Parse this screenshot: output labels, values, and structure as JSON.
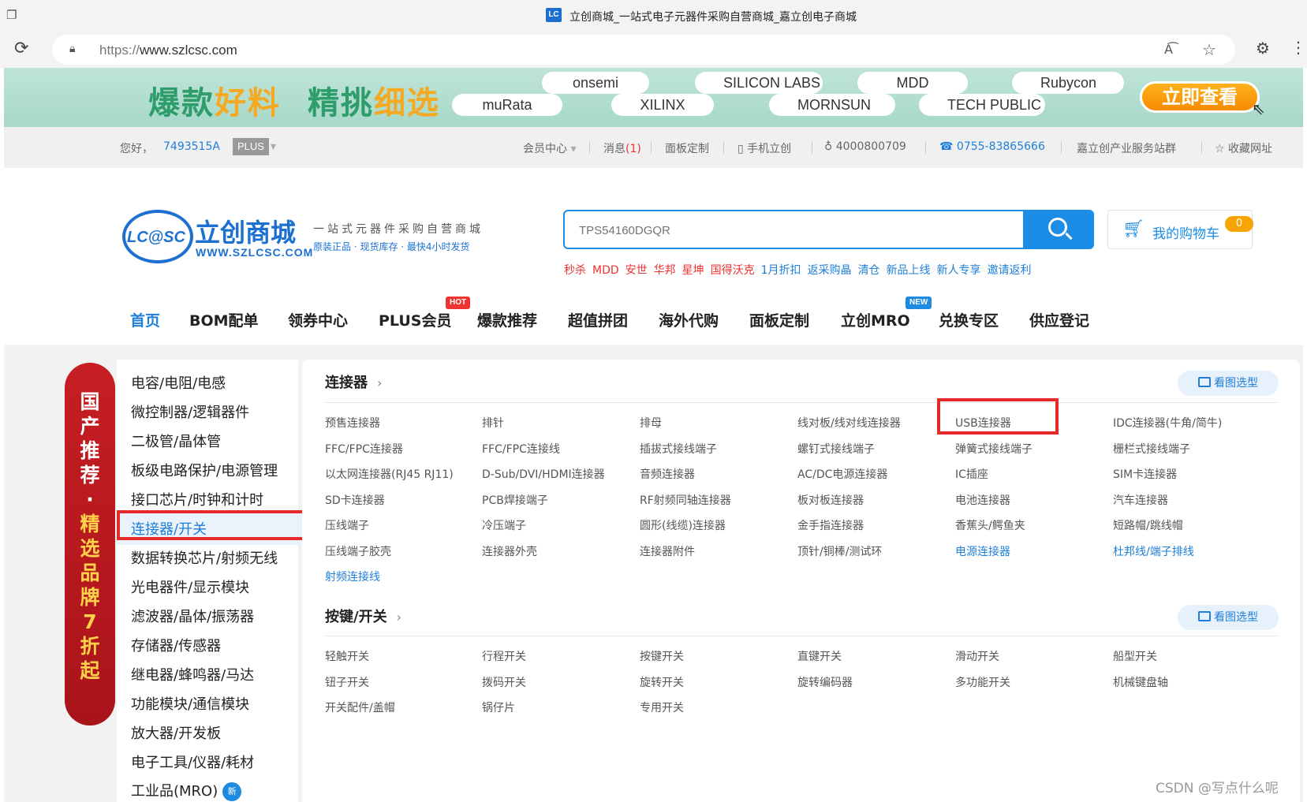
{
  "browser": {
    "tab_title": "立创商城_一站式电子元器件采购自营商城_嘉立创电子商城",
    "favicon_text": "LC",
    "url": "https://www.szlcsc.com",
    "url_scheme": "https://",
    "url_host": "www.szlcsc.com",
    "reader_icon": "Aᴬ"
  },
  "banner": {
    "slogan_green_1": "爆款",
    "slogan_yellow_1": "好料",
    "slogan_green_2": "精挑",
    "slogan_yellow_2": "细选",
    "brands": [
      "onsemi",
      "muRata",
      "XILINX",
      "SILICON LABS",
      "MORNSUN",
      "MDD",
      "TECH PUBLIC",
      "Rubycon"
    ],
    "cta_label": "立即查看",
    "colors": {
      "green": "#2e9d6b",
      "yellow": "#f5a821",
      "cta": "#f58a00"
    }
  },
  "memberbar": {
    "greeting": "您好，",
    "username": "7493515A",
    "plus_badge": "PLUS",
    "member_center": "会员中心",
    "messages_label": "消息",
    "messages_count": "(1)",
    "panel_custom": "面板定制",
    "mobile": "手机立创",
    "qq": "4000800709",
    "phone": "0755-83865666",
    "industry": "嘉立创产业服务站群",
    "favorite": "收藏网址"
  },
  "header": {
    "logo_badge": "LC@SC",
    "logo_cn": "立创商城",
    "logo_url": "WWW.SZLCSC.COM",
    "tagline_1": "一站式元器件采购自营商城",
    "tagline_2": "原装正品 · 现货库存 · 最快4小时发货",
    "search_placeholder": "TPS54160DGQR",
    "cart_label": "我的购物车",
    "cart_count": "0",
    "hotwords": [
      {
        "text": "秒杀",
        "color": "#e33"
      },
      {
        "text": "MDD",
        "color": "#e33"
      },
      {
        "text": "安世",
        "color": "#e33"
      },
      {
        "text": "华邦",
        "color": "#e33"
      },
      {
        "text": "星坤",
        "color": "#e33"
      },
      {
        "text": "国得沃克",
        "color": "#e33"
      },
      {
        "text": "1月折扣",
        "color": "#1e7ed8"
      },
      {
        "text": "返采购晶",
        "color": "#1e7ed8"
      },
      {
        "text": "清仓",
        "color": "#1e7ed8"
      },
      {
        "text": "新品上线",
        "color": "#1e7ed8"
      },
      {
        "text": "新人专享",
        "color": "#1e7ed8"
      },
      {
        "text": "邀请返利",
        "color": "#1e7ed8"
      }
    ]
  },
  "nav": {
    "items": [
      "首页",
      "BOM配单",
      "领券中心",
      "PLUS会员",
      "爆款推荐",
      "超值拼团",
      "海外代购",
      "面板定制",
      "立创MRO",
      "兑换专区",
      "供应登记"
    ],
    "hot_tag": "HOT",
    "new_tag": "NEW"
  },
  "promo": {
    "line1": "国产推荐",
    "dot": "·",
    "line2": "精选品牌",
    "line3": "7折起"
  },
  "categories": [
    "电容/电阻/电感",
    "微控制器/逻辑器件",
    "二极管/晶体管",
    "板级电路保护/电源管理",
    "接口芯片/时钟和计时",
    "连接器/开关",
    "数据转换芯片/射频无线",
    "光电器件/显示模块",
    "滤波器/晶体/振荡器",
    "存储器/传感器",
    "继电器/蜂鸣器/马达",
    "功能模块/通信模块",
    "放大器/开发板",
    "电子工具/仪器/耗材",
    "工业品(MRO)"
  ],
  "category_new_badge": "新",
  "panel": {
    "connectors": {
      "title": "连接器",
      "chevron": "›",
      "view_label": "看图选型",
      "rows": [
        [
          "预售连接器",
          "排针",
          "排母",
          "线对板/线对线连接器",
          "USB连接器",
          "IDC连接器(牛角/简牛)"
        ],
        [
          "FFC/FPC连接器",
          "FFC/FPC连接线",
          "插拔式接线端子",
          "螺钉式接线端子",
          "弹簧式接线端子",
          "栅栏式接线端子"
        ],
        [
          "以太网连接器(RJ45 RJ11)",
          "D-Sub/DVI/HDMI连接器",
          "音频连接器",
          "AC/DC电源连接器",
          "IC插座",
          "SIM卡连接器"
        ],
        [
          "SD卡连接器",
          "PCB焊接端子",
          "RF射频同轴连接器",
          "板对板连接器",
          "电池连接器",
          "汽车连接器"
        ],
        [
          "压线端子",
          "冷压端子",
          "圆形(线缆)连接器",
          "金手指连接器",
          "香蕉头/鳄鱼夹",
          "短路帽/跳线帽"
        ],
        [
          "压线端子胶壳",
          "连接器外壳",
          "连接器附件",
          "顶针/铜棒/测试环",
          "电源连接器",
          "杜邦线/端子排线"
        ],
        [
          "射频连接线"
        ]
      ]
    },
    "switches": {
      "title": "按键/开关",
      "chevron": "›",
      "view_label": "看图选型",
      "rows": [
        [
          "轻触开关",
          "行程开关",
          "按键开关",
          "直键开关",
          "滑动开关",
          "船型开关"
        ],
        [
          "钮子开关",
          "拨码开关",
          "旋转开关",
          "旋转编码器",
          "多功能开关",
          "机械键盘轴"
        ],
        [
          "开关配件/盖帽",
          "锅仔片",
          "专用开关"
        ]
      ]
    }
  },
  "watermark": "CSDN @写点什么呢"
}
